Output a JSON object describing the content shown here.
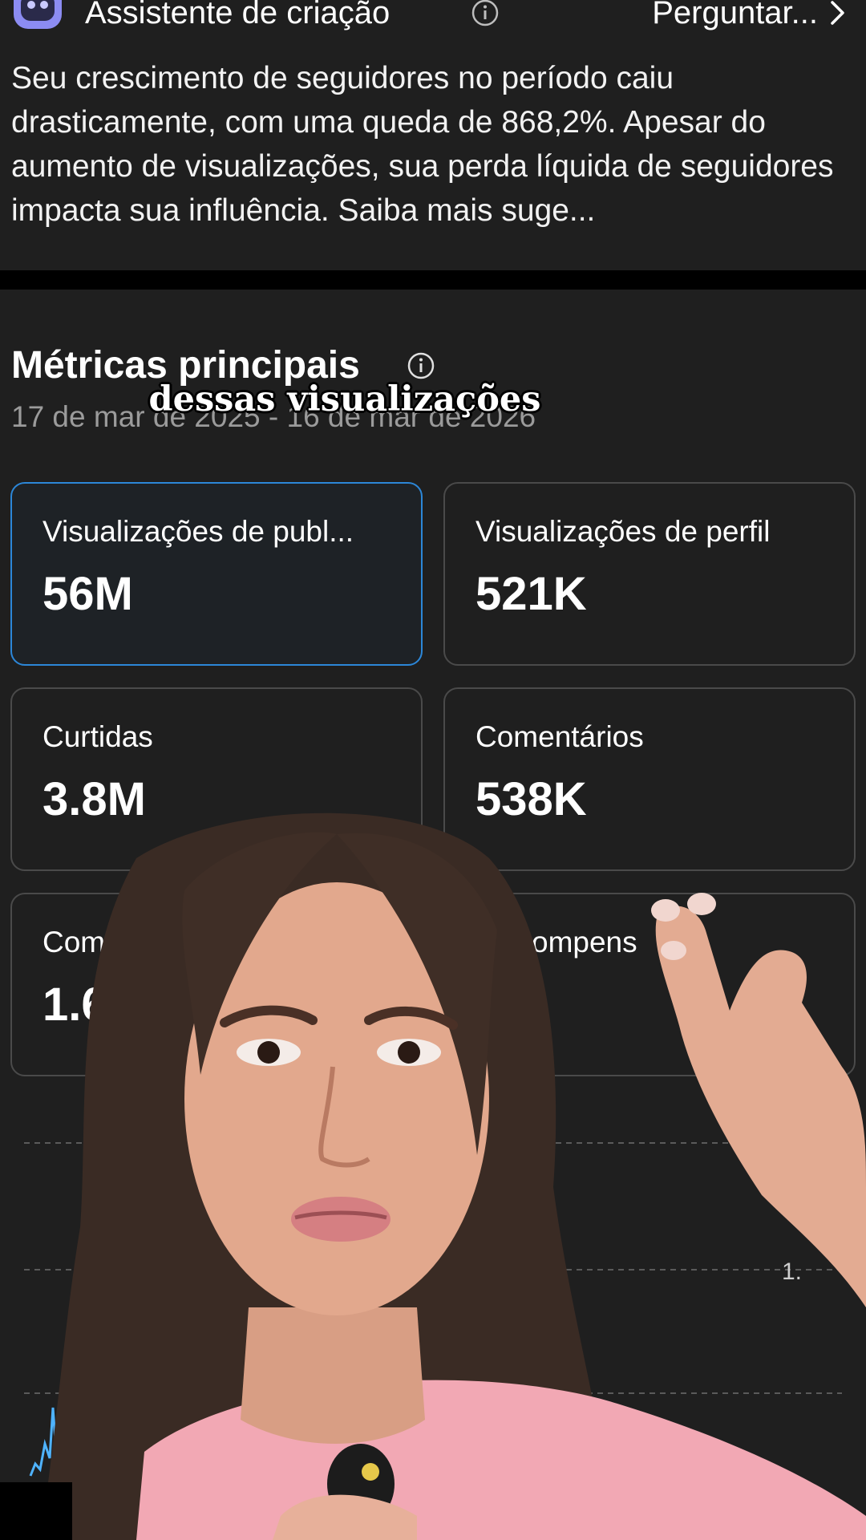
{
  "assistant": {
    "title": "Assistente de criação",
    "ask_label": "Perguntar...",
    "insight_text": "Seu crescimento de seguidores no período caiu drasticamente, com uma queda de 868,2%. Apesar do aumento de visualizações, sua perda líquida de seguidores impacta sua influência. Saiba mais suge..."
  },
  "metrics": {
    "title": "Métricas principais",
    "date_range": "17 de mar de 2025 - 16 de mar de 2026",
    "caption": "dessas visualizações",
    "cards": [
      {
        "label": "Visualizações de publ...",
        "value": "56M"
      },
      {
        "label": "Visualizações de perfil",
        "value": "521K"
      },
      {
        "label": "Curtidas",
        "value": "3.8M"
      },
      {
        "label": "Comentários",
        "value": "538K"
      },
      {
        "label": "Compa",
        "value": "1.6"
      },
      {
        "label": "ompens",
        "value": ""
      }
    ],
    "chart_tick": "1."
  },
  "colors": {
    "background": "#1f1f1f",
    "selected_border": "#2c87d8",
    "card_border": "#4a4a4a",
    "secondary_text": "#9b9b9b",
    "brand_icon": "#8c8cf2"
  }
}
